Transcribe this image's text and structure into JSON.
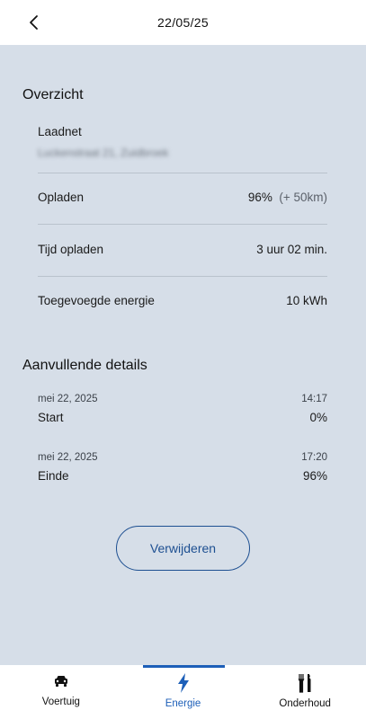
{
  "header": {
    "title": "22/05/25"
  },
  "overview": {
    "title": "Overzicht",
    "network_label": "Laadnet",
    "network_value": "Luckenstraat 21, Zuidbroek",
    "rows": [
      {
        "label": "Opladen",
        "value": "96%",
        "extra": "(+ 50km)"
      },
      {
        "label": "Tijd opladen",
        "value": "3 uur 02 min."
      },
      {
        "label": "Toegevoegde energie",
        "value": "10 kWh"
      }
    ]
  },
  "details": {
    "title": "Aanvullende details",
    "events": [
      {
        "date": "mei 22, 2025",
        "time": "14:17",
        "label": "Start",
        "value": "0%"
      },
      {
        "date": "mei 22, 2025",
        "time": "17:20",
        "label": "Einde",
        "value": "96%"
      }
    ]
  },
  "actions": {
    "delete_label": "Verwijderen"
  },
  "tabs": [
    {
      "label": "Voertuig",
      "icon": "car-icon",
      "active": false
    },
    {
      "label": "Energie",
      "icon": "lightning-icon",
      "active": true
    },
    {
      "label": "Onderhoud",
      "icon": "tools-icon",
      "active": false
    }
  ],
  "colors": {
    "accent": "#1d5fb8",
    "background": "#d6dee8"
  }
}
